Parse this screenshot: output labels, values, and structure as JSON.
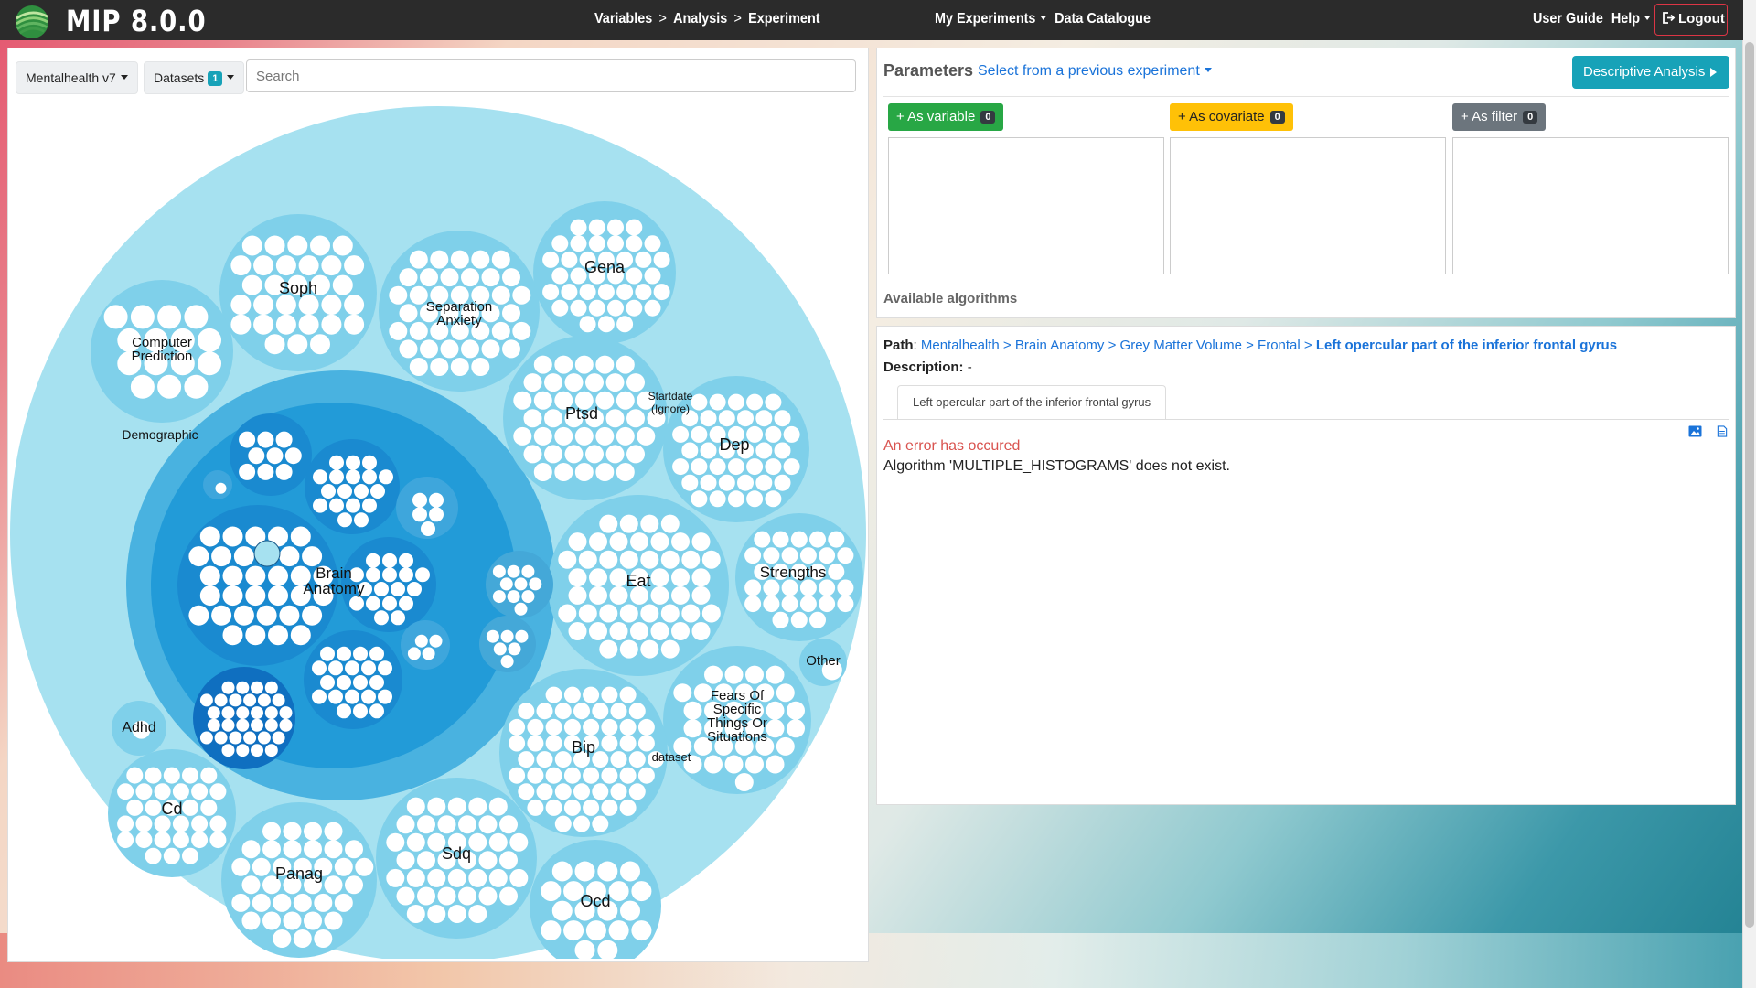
{
  "app": {
    "title": "MIP 8.0.0",
    "breadcrumb": [
      "Variables",
      "Analysis",
      "Experiment"
    ],
    "breadcrumb_separator": ">",
    "menu": {
      "my_experiments": "My Experiments",
      "data_catalogue": "Data Catalogue"
    },
    "right_menu": {
      "user_guide": "User Guide",
      "help": "Help",
      "logout": "Logout"
    }
  },
  "left": {
    "pathology_select": "Mentalhealth v7",
    "datasets_label": "Datasets",
    "datasets_count": "1",
    "search_placeholder": "Search",
    "bubble_labels": {
      "soph": "Soph",
      "separation_1": "Separation",
      "separation_2": "Anxiety",
      "gena": "Gena",
      "computer_1": "Computer",
      "computer_2": "Prediction",
      "demographic": "Demographic",
      "ptsd": "Ptsd",
      "startdate_1": "Startdate",
      "startdate_2": "(Ignore)",
      "dep": "Dep",
      "brain_1": "Brain",
      "brain_2": "Anatomy",
      "eat": "Eat",
      "strengths": "Strengths",
      "other": "Other",
      "adhd": "Adhd",
      "fears_1": "Fears Of",
      "fears_2": "Specific",
      "fears_3": "Things Or",
      "fears_4": "Situations",
      "bip": "Bip",
      "dataset": "dataset",
      "cd": "Cd",
      "panag": "Panag",
      "sdq": "Sdq",
      "ocd": "Ocd"
    }
  },
  "params": {
    "title": "Parameters",
    "select_previous": "Select from a previous experiment",
    "run_button": "Descriptive Analysis",
    "as_variable": "+ As variable",
    "as_variable_count": "0",
    "as_covariate": "+ As covariate",
    "as_covariate_count": "0",
    "as_filter": "+ As filter",
    "as_filter_count": "0",
    "available_algorithms": "Available algorithms",
    "colors": {
      "variable": "#28a745",
      "covariate": "#ffc107",
      "filter": "#6c757d",
      "accent": "#17a2b8"
    }
  },
  "info": {
    "path_label": "Path",
    "path": [
      "Mentalhealth",
      "Brain Anatomy",
      "Grey Matter Volume",
      "Frontal"
    ],
    "path_current": "Left opercular part of the inferior frontal gyrus",
    "description_label": "Description",
    "description_value": "-",
    "tab_label": "Left opercular part of the inferior frontal gyrus",
    "icons": [
      "image-icon",
      "file-icon"
    ],
    "error_title": "An error has occured",
    "error_message": "Algorithm 'MULTIPLE_HISTOGRAMS' does not exist."
  }
}
